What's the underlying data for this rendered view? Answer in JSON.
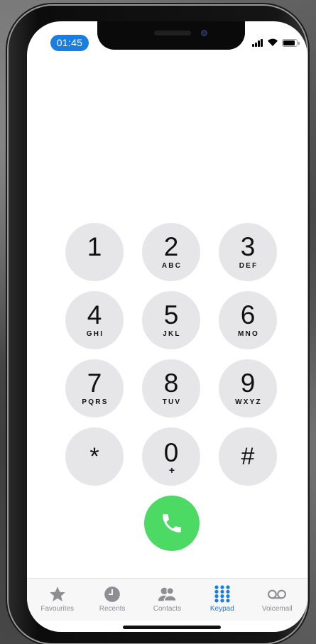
{
  "status_bar": {
    "time": "01:45",
    "signal_bars": 4,
    "battery_level": 0.9
  },
  "keypad": {
    "keys": [
      {
        "digit": "1",
        "letters": ""
      },
      {
        "digit": "2",
        "letters": "ABC"
      },
      {
        "digit": "3",
        "letters": "DEF"
      },
      {
        "digit": "4",
        "letters": "GHI"
      },
      {
        "digit": "5",
        "letters": "JKL"
      },
      {
        "digit": "6",
        "letters": "MNO"
      },
      {
        "digit": "7",
        "letters": "PQRS"
      },
      {
        "digit": "8",
        "letters": "TUV"
      },
      {
        "digit": "9",
        "letters": "WXYZ"
      },
      {
        "digit": "*",
        "letters": ""
      },
      {
        "digit": "0",
        "letters": "+"
      },
      {
        "digit": "#",
        "letters": ""
      }
    ]
  },
  "call_button": {
    "icon": "phone-icon",
    "color": "#4cd964"
  },
  "tabbar": {
    "tabs": [
      {
        "label": "Favourites",
        "icon": "star-icon",
        "active": false
      },
      {
        "label": "Recents",
        "icon": "clock-icon",
        "active": false
      },
      {
        "label": "Contacts",
        "icon": "contacts-icon",
        "active": false
      },
      {
        "label": "Keypad",
        "icon": "keypad-icon",
        "active": true
      },
      {
        "label": "Voicemail",
        "icon": "voicemail-icon",
        "active": false
      }
    ]
  },
  "colors": {
    "accent": "#1a7ee0",
    "key_bg": "#e6e6e8",
    "inactive": "#8e8e93"
  }
}
